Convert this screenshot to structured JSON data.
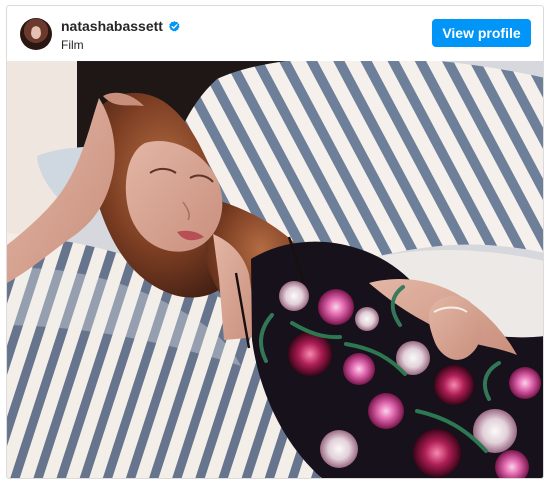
{
  "post": {
    "username": "natashabassett",
    "subtitle": "Film",
    "view_profile_label": "View profile",
    "verified_icon": "verified-badge-icon",
    "accent_color": "#0095f6"
  }
}
